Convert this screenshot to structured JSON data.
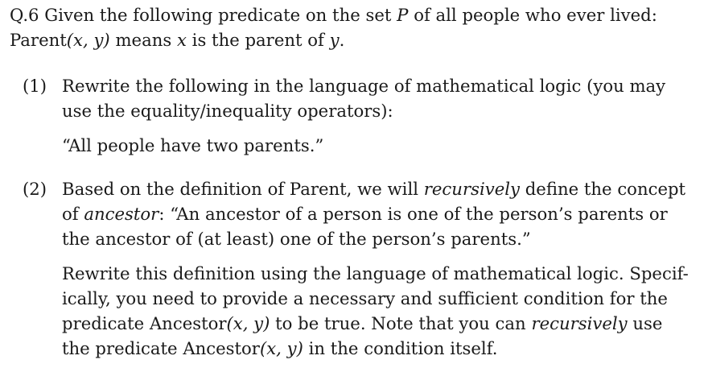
{
  "question": {
    "number": "Q.6",
    "intro_line1_a": "Given the following predicate on the set",
    "set_symbol": "P",
    "intro_line1_b": "of all people who ever lived:",
    "parent_pred": "Parent",
    "args": "(x, y)",
    "means": "means",
    "x": "x",
    "is_the_parent_of": "is the parent of",
    "y": "y",
    "period": "."
  },
  "part1": {
    "label": "(1)",
    "line1": "Rewrite the following in the language of mathematical logic (you may",
    "line2": "use the equality/inequality operators):",
    "quote": "“All people have two parents.”"
  },
  "part2": {
    "label": "(2)",
    "line1": "Based on the definition of Parent, we will",
    "line1_em": "recursively",
    "line1_end": "define the concept",
    "line2_a": "of",
    "line2_em": "ancestor",
    "line2_b": ": “An ancestor of a person is one of the person’s parents or",
    "line3": "the ancestor of (at least) one of the person’s parents.”",
    "p2_line1": "Rewrite this definition using the language of mathematical logic. Specif-",
    "p2_line2": "ically, you need to provide a necessary and sufficient condition for the",
    "p2_line3_a": "predicate",
    "ancestor_pred": "Ancestor",
    "p2_line3_args": "(x, y)",
    "p2_line3_b": "to be true. Note that you can",
    "p2_line3_em": "recursively",
    "p2_line3_c": "use",
    "p2_line4_a": "the predicate",
    "p2_line4_args": "(x, y)",
    "p2_line4_b": "in the condition itself."
  }
}
